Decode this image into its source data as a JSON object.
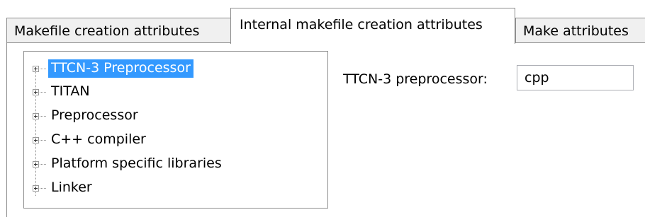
{
  "tabs": [
    {
      "label": "Makefile creation attributes",
      "active": false
    },
    {
      "label": "Internal makefile creation attributes",
      "active": true
    },
    {
      "label": "Make attributes",
      "active": false
    }
  ],
  "tree": {
    "items": [
      {
        "label": "TTCN-3 Preprocessor",
        "selected": true,
        "icon": "expand-plus-icon"
      },
      {
        "label": "TITAN",
        "selected": false,
        "icon": "expand-plus-icon"
      },
      {
        "label": "Preprocessor",
        "selected": false,
        "icon": "expand-plus-icon"
      },
      {
        "label": "C++ compiler",
        "selected": false,
        "icon": "expand-plus-icon"
      },
      {
        "label": "Platform specific libraries",
        "selected": false,
        "icon": "expand-plus-icon"
      },
      {
        "label": "Linker",
        "selected": false,
        "icon": "expand-plus-icon"
      }
    ]
  },
  "preprocessor_field": {
    "label": "TTCN-3 preprocessor:",
    "value": "cpp"
  },
  "colors": {
    "selection": "#3399ff",
    "border": "#8d8d8d",
    "tab_inactive_bg": "#f0f0f0"
  }
}
